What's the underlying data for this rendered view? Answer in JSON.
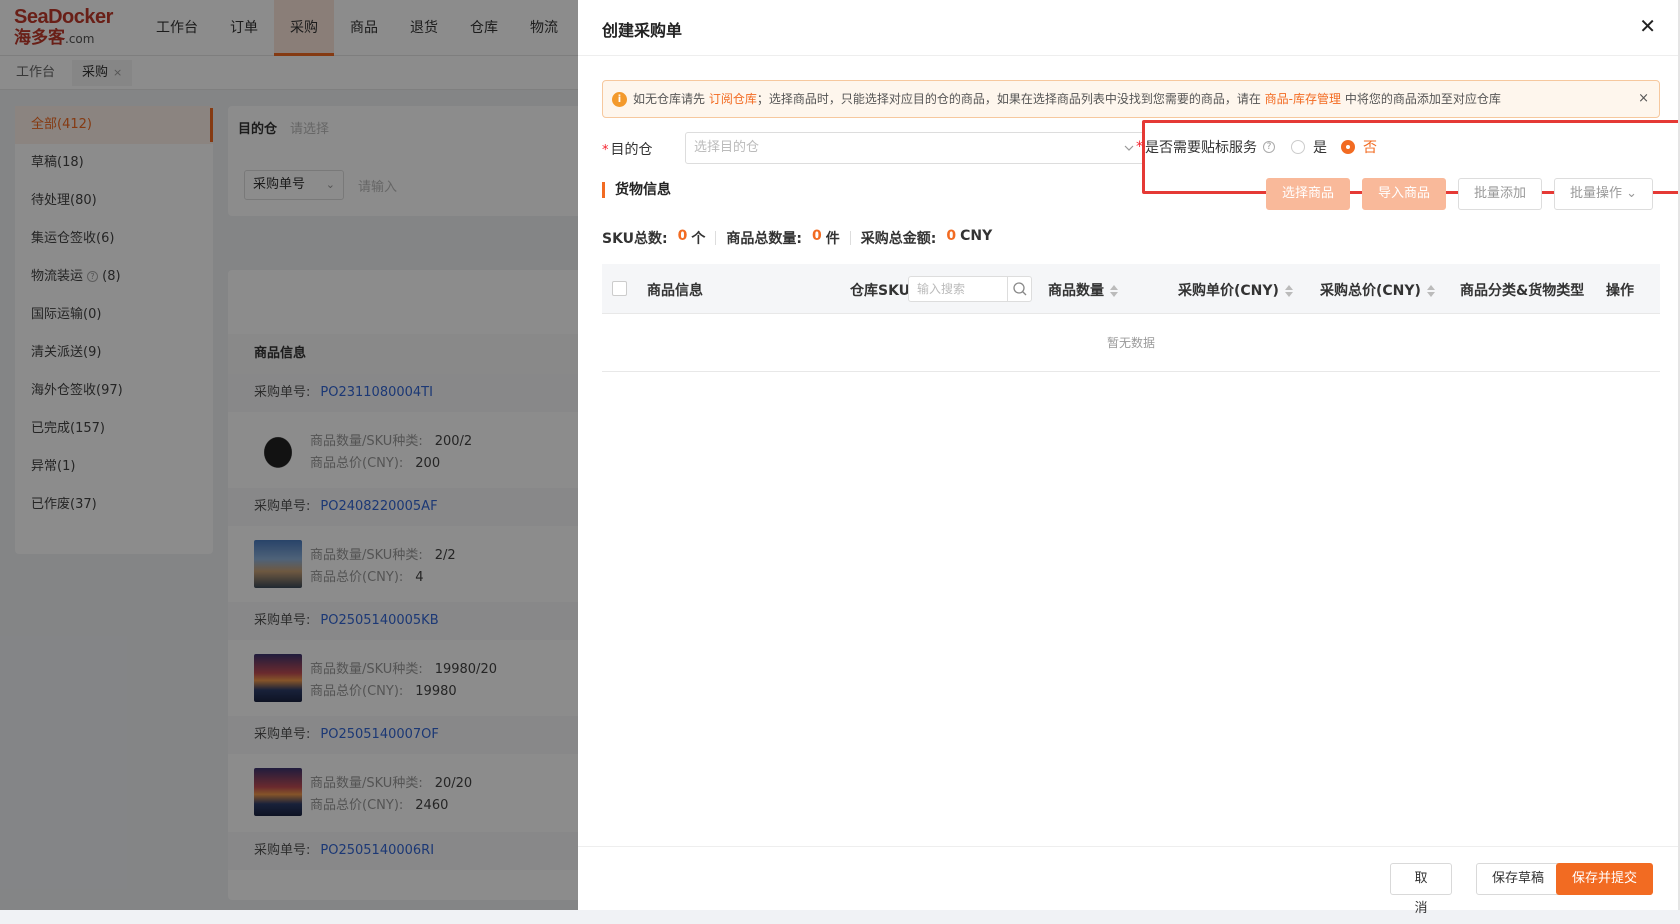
{
  "app": {
    "logo_main": "SeaDocker",
    "logo_sub": "海多客",
    "logo_domain": ".com",
    "nav": [
      "工作台",
      "订单",
      "采购",
      "商品",
      "退货",
      "仓库",
      "物流"
    ],
    "tabs": [
      "工作台",
      "采购"
    ],
    "tab_close": "×"
  },
  "sidebar": {
    "items": [
      {
        "label": "全部(412)"
      },
      {
        "label": "草稿(18)"
      },
      {
        "label": "待处理(80)"
      },
      {
        "label": "集运仓签收(6)"
      },
      {
        "label": "物流装运",
        "count": "(8)"
      },
      {
        "label": "国际运输(0)"
      },
      {
        "label": "清关派送(9)"
      },
      {
        "label": "海外仓签收(97)"
      },
      {
        "label": "已完成(157)"
      },
      {
        "label": "异常(1)"
      },
      {
        "label": "已作废(37)"
      }
    ]
  },
  "filters": {
    "dest_label": "目的仓",
    "dest_placeholder": "请选择",
    "po_select": "采购单号",
    "po_placeholder": "请输入"
  },
  "list": {
    "header": "商品信息",
    "po_label": "采购单号:",
    "qty_label": "商品数量/SKU种类:",
    "total_label": "商品总价(CNY):",
    "orders": [
      {
        "po": "PO2311080004TI",
        "qty": "200/2",
        "total": "200"
      },
      {
        "po": "PO2408220005AF",
        "qty": "2/2",
        "total": "4"
      },
      {
        "po": "PO2505140005KB",
        "qty": "19980/20",
        "total": "19980"
      },
      {
        "po": "PO2505140007OF",
        "qty": "20/20",
        "total": "2460"
      },
      {
        "po": "PO2505140006RI"
      }
    ]
  },
  "drawer": {
    "title": "创建采购单",
    "close": "✕",
    "alert": {
      "icon": "i",
      "t1": "如无仓库请先 ",
      "link1": "订阅仓库",
      "t2": "；选择商品时，只能选择对应目的仓的商品，如果在选择商品列表中没找到您需要的商品，请在 ",
      "link2": "商品-库存管理",
      "t3": " 中将您的商品添加至对应仓库",
      "close": "×"
    },
    "req_mark": "*",
    "dest_label": "目的仓",
    "dest_placeholder": "选择目的仓",
    "label_service": "是否需要贴标服务",
    "help_icon": "?",
    "opt_yes": "是",
    "opt_no": "否",
    "selected_option": "否",
    "section_title": "货物信息",
    "buttons": {
      "select_goods": "选择商品",
      "import_goods": "导入商品",
      "batch_add": "批量添加",
      "batch_ops": "批量操作"
    },
    "stats": {
      "sku_label": "SKU总数:",
      "sku_value": "0",
      "sku_unit": "个",
      "qty_label": "商品总数量:",
      "qty_value": "0",
      "qty_unit": "件",
      "amount_label": "采购总金额:",
      "amount_value": "0",
      "amount_unit": "CNY"
    },
    "table": {
      "col_info": "商品信息",
      "col_sku": "仓库SKU",
      "sku_placeholder": "输入搜索",
      "col_qty": "商品数量",
      "col_unit_price": "采购单价(CNY)",
      "col_total": "采购总价(CNY)",
      "col_category": "商品分类&货物类型",
      "col_action": "操作",
      "empty": "暂无数据"
    },
    "footer": {
      "cancel": "取 消",
      "save_draft": "保存草稿",
      "save_submit": "保存并提交"
    }
  },
  "colors": {
    "accent": "#f26b22",
    "highlight_box": "#e53935",
    "link": "#3367d6"
  }
}
